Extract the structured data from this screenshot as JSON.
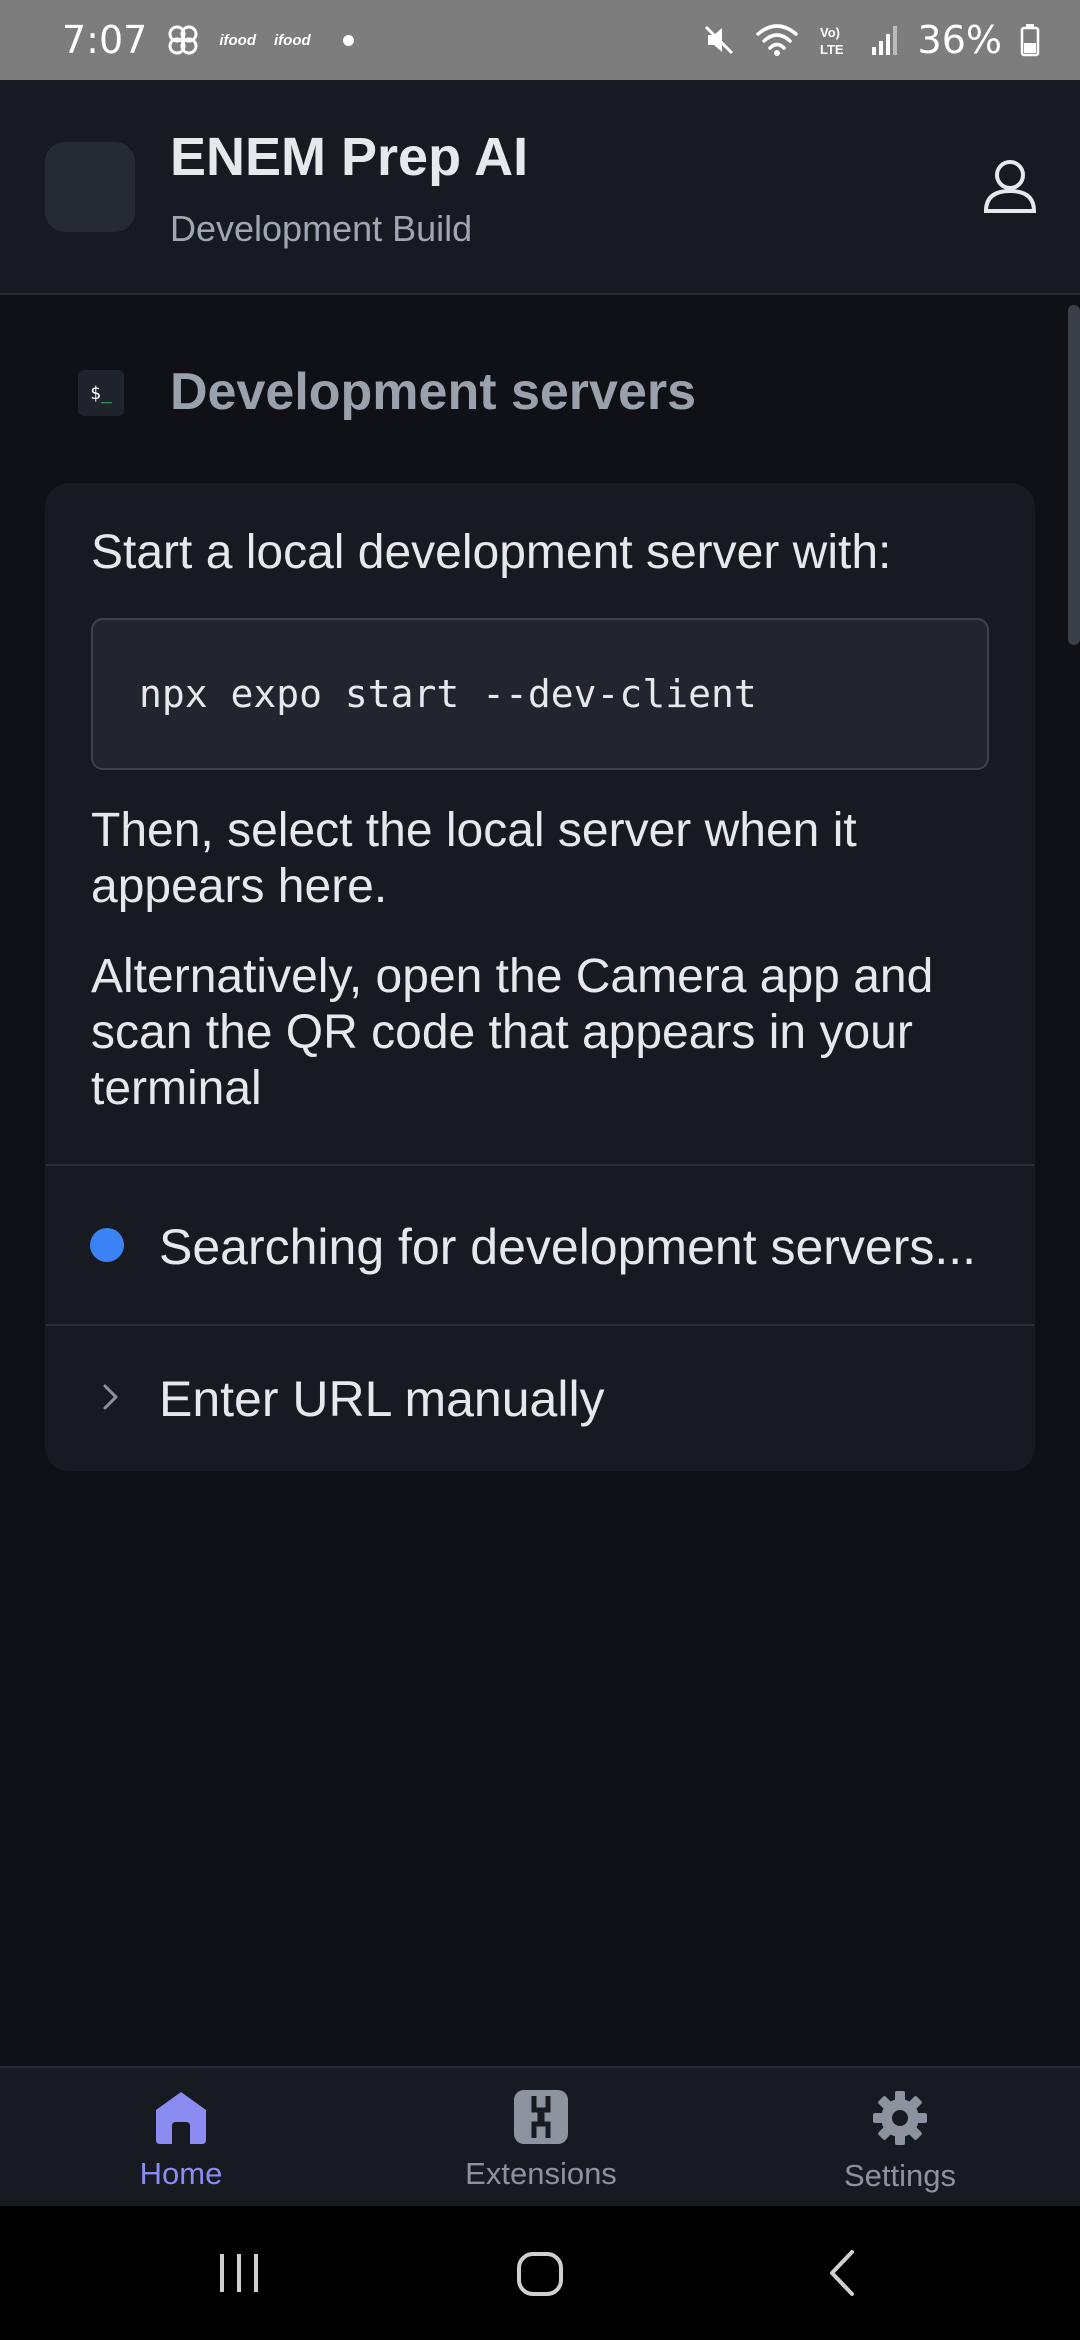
{
  "status_bar": {
    "time": "7:07",
    "notif_1": "ifood",
    "notif_2": "ifood",
    "battery": "36%"
  },
  "header": {
    "app_name": "ENEM Prep AI",
    "subtitle": "Development Build"
  },
  "section": {
    "title": "Development servers",
    "icon_text": "$",
    "icon_cursor": "_"
  },
  "card": {
    "intro": "Start a local development server with:",
    "command": "npx expo start --dev-client",
    "paragraph_1": "Then, select the local server when it appears here.",
    "paragraph_2": "Alternatively, open the Camera app and scan the QR code that appears in your terminal",
    "searching": "Searching for development servers...",
    "enter_url": "Enter URL manually"
  },
  "bottom_nav": {
    "items": [
      {
        "label": "Home",
        "icon": "home-icon",
        "active": true
      },
      {
        "label": "Extensions",
        "icon": "extensions-icon",
        "active": false
      },
      {
        "label": "Settings",
        "icon": "gear-icon",
        "active": false
      }
    ]
  },
  "colors": {
    "background": "#0f1117",
    "surface": "#171a21",
    "accent": "#8b8cf2",
    "status_dot": "#3b82f6"
  }
}
